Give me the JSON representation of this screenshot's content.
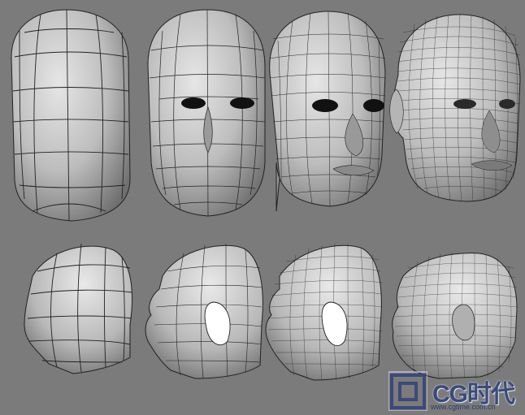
{
  "image": {
    "description_items": [
      {
        "row": "front",
        "stage": 1,
        "detail": "low-poly"
      },
      {
        "row": "front",
        "stage": 2,
        "detail": "eye-holes-nose"
      },
      {
        "row": "front",
        "stage": 3,
        "detail": "facial-features"
      },
      {
        "row": "front",
        "stage": 4,
        "detail": "high-detail-ears"
      },
      {
        "row": "side",
        "stage": 1,
        "detail": "low-poly"
      },
      {
        "row": "side",
        "stage": 2,
        "detail": "ear-hole"
      },
      {
        "row": "side",
        "stage": 3,
        "detail": "dense-mesh"
      },
      {
        "row": "side",
        "stage": 4,
        "detail": "high-detail-ear"
      }
    ],
    "background_color": "#7b7b7b",
    "mesh_fill": "#cfcfcf",
    "wire_color": "#1a1a1a"
  },
  "watermark": {
    "name": "CG时代",
    "url": "www.cgtime.com.cn",
    "logo_icon": "cg-logo-icon",
    "color": "#3a4a7a"
  }
}
